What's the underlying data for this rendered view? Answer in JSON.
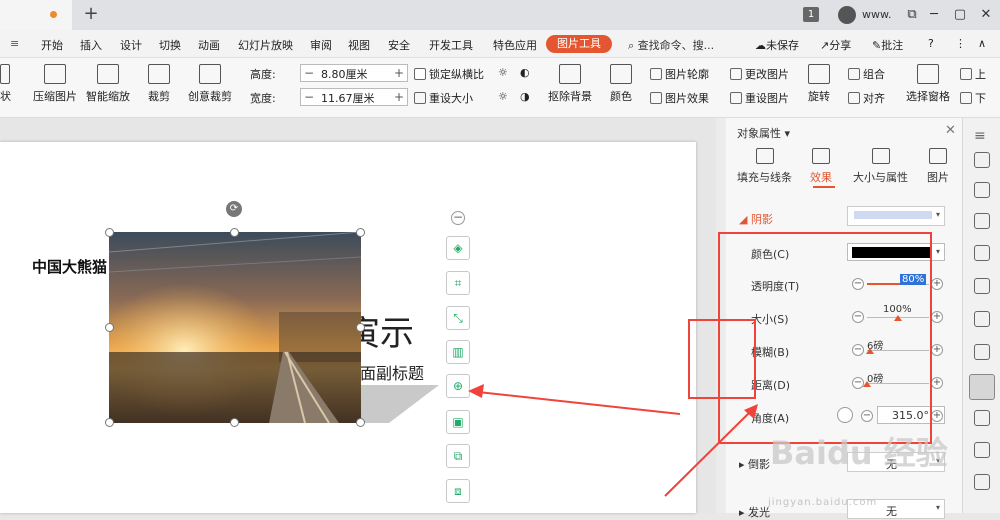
{
  "tabbar": {
    "new_tab": "+",
    "badge": "1",
    "account": "www.",
    "win_restore": "⧉",
    "win_minimize": "─",
    "win_maximize": "▢",
    "win_close": "✕"
  },
  "menu": {
    "items": [
      "开始",
      "插入",
      "设计",
      "切换",
      "动画",
      "幻灯片放映",
      "审阅",
      "视图",
      "安全",
      "开发工具",
      "特色应用"
    ],
    "picture_tools": "图片工具",
    "search": "查找命令、搜...",
    "unsaved": "未保存",
    "share": "分享",
    "comment": "批注",
    "help": "?"
  },
  "ribbon": {
    "compress": "压缩图片",
    "smart_scale": "智能缩放",
    "crop": "裁剪",
    "creative_crop": "创意裁剪",
    "height_label": "高度:",
    "height_value": "8.80厘米",
    "width_label": "宽度:",
    "width_value": "11.67厘米",
    "lock_ratio": "锁定纵横比",
    "reset_size": "重设大小",
    "remove_bg": "抠除背景",
    "color": "颜色",
    "outline": "图片轮廓",
    "effects": "图片效果",
    "change_pic": "更改图片",
    "reset_pic": "重设图片",
    "rotate": "旋转",
    "group": "组合",
    "align": "对齐",
    "selection_pane": "选择窗格",
    "up": "上",
    "down": "下",
    "shape_label": "状"
  },
  "slide": {
    "left_text": "中国大熊猫",
    "title_part": "寅示",
    "subtitle_part": "面副标题"
  },
  "float_toolbar": {
    "collapse": "−",
    "icons": [
      "layers-icon",
      "crop-icon",
      "transform-icon",
      "picture-split-icon",
      "zoom-in-icon",
      "select-frame-icon",
      "picture-replace-icon",
      "picture-copy-icon"
    ]
  },
  "panel": {
    "title": "对象属性",
    "tabs": [
      "填充与线条",
      "效果",
      "大小与属性",
      "图片"
    ],
    "active_tab": "效果",
    "shadow_section": "阴影",
    "rows": {
      "color": "颜色(C)",
      "transparency": "透明度(T)",
      "size": "大小(S)",
      "blur": "模糊(B)",
      "distance": "距离(D)",
      "angle": "角度(A)"
    },
    "values": {
      "transparency": "80%",
      "transparency_level": 0.8,
      "size": "100%",
      "size_level": 0.5,
      "blur": "6磅",
      "blur_level": 0.05,
      "distance": "0磅",
      "distance_level": 0.0,
      "angle": "315.0°"
    },
    "reflection_section": "倒影",
    "reflection_value": "无",
    "glow_section": "发光",
    "glow_value": "无"
  },
  "colors": {
    "accent": "#e4562f",
    "annotation_red": "#f0443a",
    "shadow_color": "#000000"
  },
  "watermark": {
    "main": "Baidu 经验",
    "sub": "jingyan.baidu.com"
  }
}
